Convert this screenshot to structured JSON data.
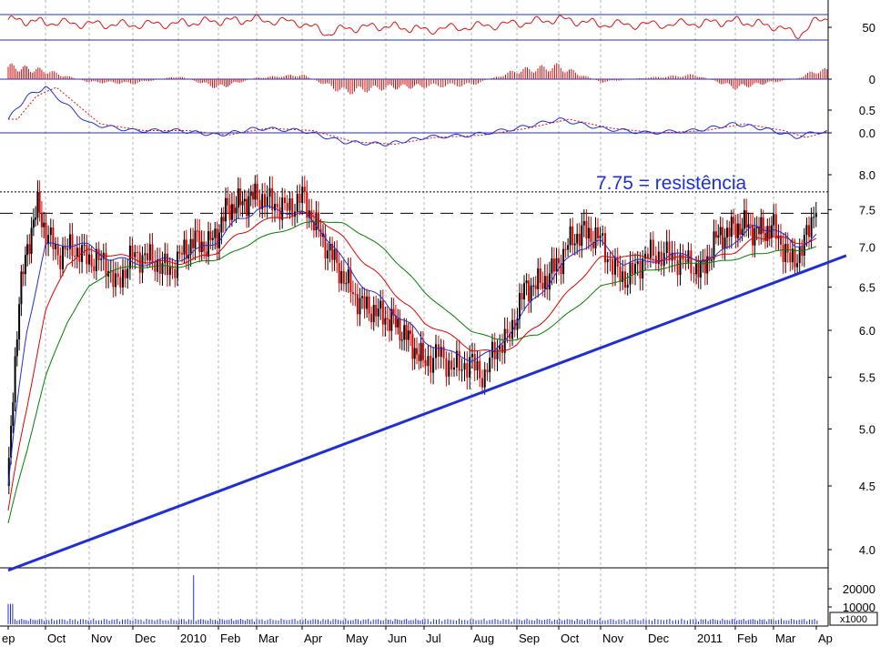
{
  "chart_data": {
    "type": "candlestick",
    "annotation": "7.75 = resistência",
    "x_tick_labels": [
      "ep",
      "Oct",
      "Nov",
      "Dec",
      "2010",
      "Feb",
      "Mar",
      "Apr",
      "May",
      "Jun",
      "Jul",
      "Aug",
      "Sep",
      "Oct",
      "Nov",
      "Dec",
      "2011",
      "Feb",
      "Mar",
      "Ap"
    ],
    "panels": {
      "oscillator": {
        "tick_labels": [
          "50"
        ],
        "reference_levels": [
          70,
          30
        ]
      },
      "histogram": {
        "tick_labels": [
          "0"
        ]
      },
      "macd": {
        "tick_labels": [
          "0.5",
          "0.0"
        ]
      },
      "price": {
        "scale": "log",
        "tick_labels": [
          "8.0",
          "7.5",
          "7.0",
          "6.5",
          "6.0",
          "5.5",
          "5.0",
          "4.5",
          "4.0"
        ],
        "ylim": [
          3.8,
          8.3
        ],
        "resistance_level": 7.75,
        "dashed_level": 7.45
      },
      "volume": {
        "tick_labels": [
          "20000",
          "10000"
        ],
        "unit_label": "x1000"
      }
    },
    "price_path": [
      [
        0,
        4.5
      ],
      [
        0.3,
        6.4
      ],
      [
        0.6,
        7.2
      ],
      [
        0.8,
        7.55
      ],
      [
        1.0,
        7.2
      ],
      [
        1.3,
        6.9
      ],
      [
        1.6,
        7.0
      ],
      [
        2.0,
        6.85
      ],
      [
        2.4,
        6.8
      ],
      [
        2.6,
        6.5
      ],
      [
        3.0,
        6.9
      ],
      [
        3.4,
        6.85
      ],
      [
        3.8,
        6.7
      ],
      [
        4.0,
        6.85
      ],
      [
        4.4,
        7.1
      ],
      [
        4.7,
        7.0
      ],
      [
        5.0,
        7.2
      ],
      [
        5.2,
        7.5
      ],
      [
        5.6,
        7.6
      ],
      [
        6.0,
        7.7
      ],
      [
        6.3,
        7.6
      ],
      [
        6.7,
        7.5
      ],
      [
        7.0,
        7.7
      ],
      [
        7.3,
        7.3
      ],
      [
        7.6,
        7.0
      ],
      [
        8.0,
        6.6
      ],
      [
        8.4,
        6.3
      ],
      [
        8.8,
        6.2
      ],
      [
        9.2,
        6.1
      ],
      [
        9.6,
        5.9
      ],
      [
        10.0,
        5.65
      ],
      [
        10.3,
        5.75
      ],
      [
        10.6,
        5.6
      ],
      [
        11.0,
        5.65
      ],
      [
        11.3,
        5.5
      ],
      [
        11.5,
        5.8
      ],
      [
        11.8,
        5.9
      ],
      [
        12.2,
        6.5
      ],
      [
        12.6,
        6.55
      ],
      [
        13.0,
        6.8
      ],
      [
        13.3,
        7.1
      ],
      [
        13.6,
        7.2
      ],
      [
        14.0,
        7.1
      ],
      [
        14.3,
        6.7
      ],
      [
        14.6,
        6.6
      ],
      [
        15.0,
        6.9
      ],
      [
        15.4,
        6.9
      ],
      [
        15.8,
        6.8
      ],
      [
        16.2,
        6.7
      ],
      [
        16.5,
        7.1
      ],
      [
        16.8,
        7.2
      ],
      [
        17.2,
        7.3
      ],
      [
        17.6,
        7.2
      ],
      [
        18.0,
        7.25
      ],
      [
        18.4,
        6.8
      ],
      [
        18.7,
        7.0
      ],
      [
        18.9,
        7.4
      ],
      [
        19.0,
        7.6
      ]
    ],
    "ma_fast_path": [
      [
        0,
        4.5
      ],
      [
        0.5,
        6.0
      ],
      [
        1.0,
        7.0
      ],
      [
        1.5,
        7.05
      ],
      [
        2.0,
        7.0
      ],
      [
        2.5,
        6.85
      ],
      [
        3.0,
        6.8
      ],
      [
        3.5,
        6.8
      ],
      [
        4.0,
        6.85
      ],
      [
        4.5,
        6.95
      ],
      [
        5.0,
        7.1
      ],
      [
        5.5,
        7.35
      ],
      [
        6.0,
        7.5
      ],
      [
        6.5,
        7.5
      ],
      [
        7.0,
        7.45
      ],
      [
        7.5,
        7.2
      ],
      [
        8.0,
        6.8
      ],
      [
        8.5,
        6.5
      ],
      [
        9.0,
        6.3
      ],
      [
        9.5,
        6.1
      ],
      [
        10.0,
        5.9
      ],
      [
        10.5,
        5.75
      ],
      [
        11.0,
        5.7
      ],
      [
        11.5,
        5.75
      ],
      [
        12.0,
        6.1
      ],
      [
        12.5,
        6.4
      ],
      [
        13.0,
        6.7
      ],
      [
        13.5,
        7.0
      ],
      [
        14.0,
        7.05
      ],
      [
        14.5,
        6.8
      ],
      [
        15.0,
        6.8
      ],
      [
        15.5,
        6.9
      ],
      [
        16.0,
        6.85
      ],
      [
        16.5,
        6.85
      ],
      [
        17.0,
        7.1
      ],
      [
        17.5,
        7.25
      ],
      [
        18.0,
        7.25
      ],
      [
        18.5,
        7.0
      ],
      [
        19.0,
        7.15
      ]
    ],
    "ma_mid_path": [
      [
        0,
        4.3
      ],
      [
        0.5,
        5.2
      ],
      [
        1.0,
        6.2
      ],
      [
        1.5,
        6.8
      ],
      [
        2.0,
        6.95
      ],
      [
        2.5,
        6.9
      ],
      [
        3.0,
        6.85
      ],
      [
        3.5,
        6.8
      ],
      [
        4.0,
        6.8
      ],
      [
        4.5,
        6.85
      ],
      [
        5.0,
        6.95
      ],
      [
        5.5,
        7.15
      ],
      [
        6.0,
        7.3
      ],
      [
        6.5,
        7.4
      ],
      [
        7.0,
        7.45
      ],
      [
        7.5,
        7.35
      ],
      [
        8.0,
        7.1
      ],
      [
        8.5,
        6.8
      ],
      [
        9.0,
        6.55
      ],
      [
        9.5,
        6.3
      ],
      [
        10.0,
        6.1
      ],
      [
        10.5,
        5.95
      ],
      [
        11.0,
        5.8
      ],
      [
        11.5,
        5.75
      ],
      [
        12.0,
        5.85
      ],
      [
        12.5,
        6.05
      ],
      [
        13.0,
        6.3
      ],
      [
        13.5,
        6.6
      ],
      [
        14.0,
        6.85
      ],
      [
        14.5,
        6.9
      ],
      [
        15.0,
        6.85
      ],
      [
        15.5,
        6.85
      ],
      [
        16.0,
        6.85
      ],
      [
        16.5,
        6.85
      ],
      [
        17.0,
        6.95
      ],
      [
        17.5,
        7.1
      ],
      [
        18.0,
        7.15
      ],
      [
        18.5,
        7.05
      ],
      [
        19.0,
        7.1
      ]
    ],
    "ma_slow_path": [
      [
        0,
        4.2
      ],
      [
        0.5,
        4.8
      ],
      [
        1.0,
        5.5
      ],
      [
        1.5,
        6.1
      ],
      [
        2.0,
        6.5
      ],
      [
        2.5,
        6.7
      ],
      [
        3.0,
        6.75
      ],
      [
        3.5,
        6.75
      ],
      [
        4.0,
        6.75
      ],
      [
        4.5,
        6.8
      ],
      [
        5.0,
        6.85
      ],
      [
        5.5,
        6.95
      ],
      [
        6.0,
        7.1
      ],
      [
        6.5,
        7.2
      ],
      [
        7.0,
        7.3
      ],
      [
        7.5,
        7.35
      ],
      [
        8.0,
        7.3
      ],
      [
        8.5,
        7.15
      ],
      [
        9.0,
        6.95
      ],
      [
        9.5,
        6.7
      ],
      [
        10.0,
        6.45
      ],
      [
        10.5,
        6.2
      ],
      [
        11.0,
        6.0
      ],
      [
        11.5,
        5.9
      ],
      [
        12.0,
        5.9
      ],
      [
        12.5,
        5.95
      ],
      [
        13.0,
        6.1
      ],
      [
        13.5,
        6.3
      ],
      [
        14.0,
        6.5
      ],
      [
        14.5,
        6.6
      ],
      [
        15.0,
        6.7
      ],
      [
        15.5,
        6.75
      ],
      [
        16.0,
        6.8
      ],
      [
        16.5,
        6.8
      ],
      [
        17.0,
        6.85
      ],
      [
        17.5,
        6.9
      ],
      [
        18.0,
        6.95
      ],
      [
        18.5,
        6.95
      ],
      [
        19.0,
        7.0
      ]
    ],
    "trendline": {
      "start": [
        0,
        3.85
      ],
      "end": [
        20,
        6.95
      ]
    },
    "oscillator_path": [
      [
        0,
        62
      ],
      [
        1,
        58
      ],
      [
        2,
        55
      ],
      [
        3,
        54
      ],
      [
        4,
        56
      ],
      [
        5,
        60
      ],
      [
        6,
        62
      ],
      [
        7,
        57
      ],
      [
        7.6,
        40
      ],
      [
        8,
        48
      ],
      [
        9,
        52
      ],
      [
        10,
        46
      ],
      [
        11,
        51
      ],
      [
        12,
        56
      ],
      [
        13,
        63
      ],
      [
        14,
        55
      ],
      [
        15,
        54
      ],
      [
        16,
        56
      ],
      [
        17,
        60
      ],
      [
        18,
        52
      ],
      [
        18.6,
        38
      ],
      [
        19,
        60
      ],
      [
        19.3,
        66
      ]
    ],
    "histogram_path": [
      [
        0,
        0.9
      ],
      [
        1,
        0.6
      ],
      [
        2,
        -0.2
      ],
      [
        3,
        -0.3
      ],
      [
        4,
        0.2
      ],
      [
        5,
        -0.6
      ],
      [
        6,
        0.1
      ],
      [
        7,
        0.3
      ],
      [
        8,
        -0.9
      ],
      [
        9,
        -0.6
      ],
      [
        10,
        -0.5
      ],
      [
        11,
        -0.4
      ],
      [
        12,
        0.6
      ],
      [
        13,
        0.9
      ],
      [
        14,
        -0.2
      ],
      [
        15,
        0.1
      ],
      [
        16,
        0.3
      ],
      [
        17,
        -0.6
      ],
      [
        18,
        -0.2
      ],
      [
        18.5,
        0.0
      ],
      [
        19,
        0.6
      ]
    ],
    "macd_path": [
      [
        0,
        0.3
      ],
      [
        0.5,
        0.8
      ],
      [
        1,
        1.0
      ],
      [
        1.5,
        0.6
      ],
      [
        2,
        0.2
      ],
      [
        3,
        0.05
      ],
      [
        4,
        0.05
      ],
      [
        5,
        -0.05
      ],
      [
        6,
        0.1
      ],
      [
        7,
        0.05
      ],
      [
        8,
        -0.2
      ],
      [
        9,
        -0.25
      ],
      [
        10,
        -0.1
      ],
      [
        11,
        -0.05
      ],
      [
        12,
        0.1
      ],
      [
        13,
        0.3
      ],
      [
        14,
        0.1
      ],
      [
        15,
        0.0
      ],
      [
        16,
        0.05
      ],
      [
        17,
        0.2
      ],
      [
        18,
        0.05
      ],
      [
        18.5,
        -0.1
      ],
      [
        19,
        0.02
      ]
    ],
    "volume_spike": {
      "x": 4.4,
      "value": 24000
    }
  }
}
